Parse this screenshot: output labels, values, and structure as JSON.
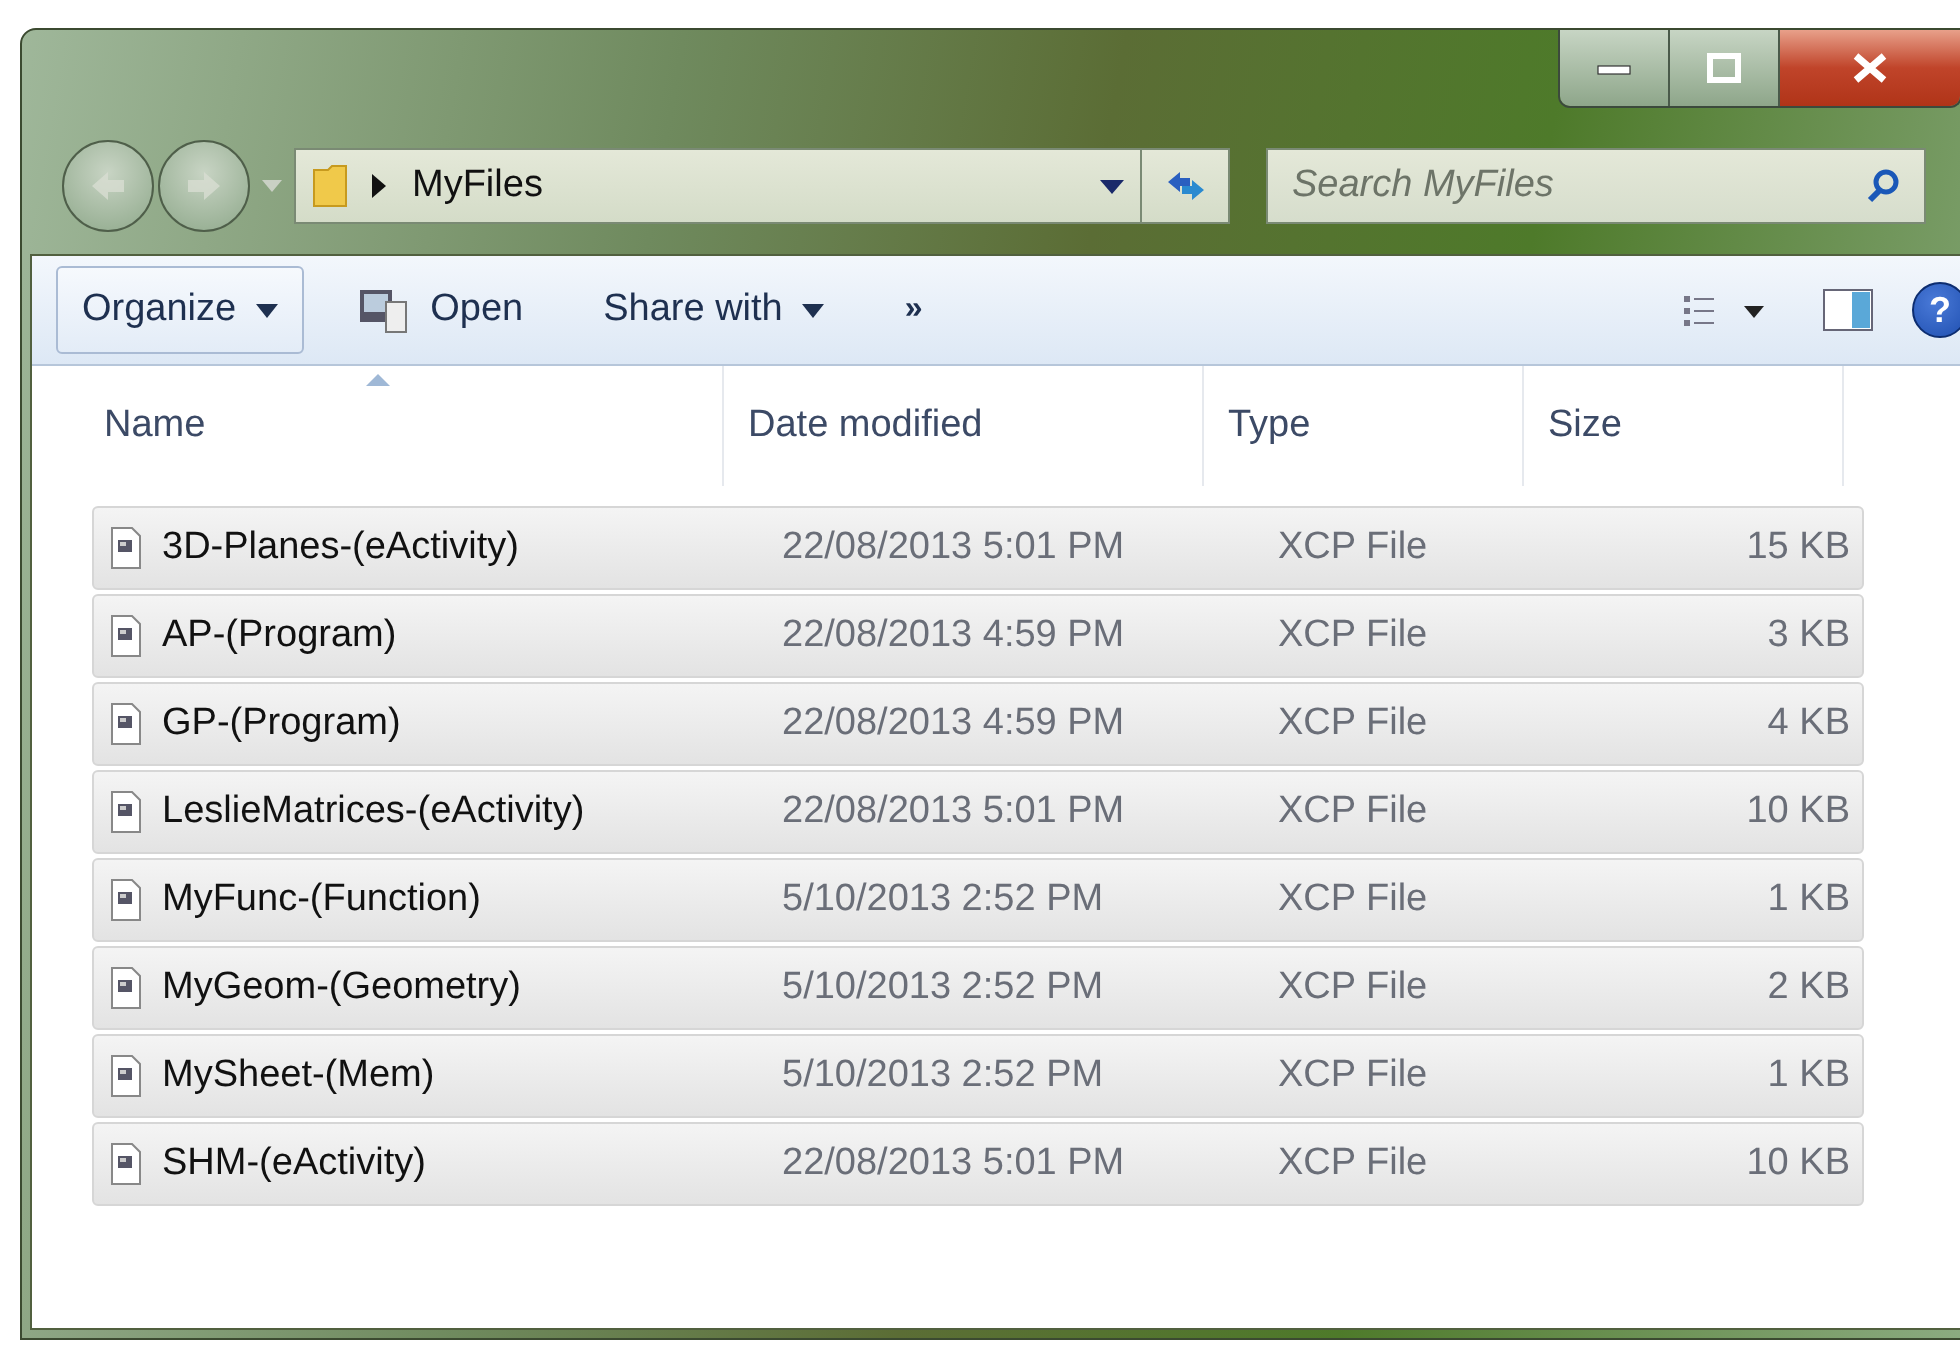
{
  "address_bar": {
    "path": "MyFiles"
  },
  "search": {
    "placeholder": "Search MyFiles"
  },
  "toolbar": [
    {
      "label": "Organize",
      "kind": "menu"
    },
    {
      "label": "Open",
      "kind": "icon"
    },
    {
      "label": "Share with",
      "kind": "menu"
    },
    {
      "label": "»",
      "kind": "more"
    }
  ],
  "help_button": {
    "label": "?"
  },
  "table": {
    "columns": [
      {
        "label": "Name",
        "sorted": true
      },
      {
        "label": "Date modified",
        "sorted": false
      },
      {
        "label": "Type",
        "sorted": false
      },
      {
        "label": "Size",
        "sorted": false
      }
    ],
    "rows": [
      {
        "name": "3D-Planes-(eActivity)",
        "date": "22/08/2013 5:01 PM",
        "type": "XCP File",
        "size": "15 KB",
        "selected": true
      },
      {
        "name": "AP-(Program)",
        "date": "22/08/2013 4:59 PM",
        "type": "XCP File",
        "size": "3 KB",
        "selected": true
      },
      {
        "name": "GP-(Program)",
        "date": "22/08/2013 4:59 PM",
        "type": "XCP File",
        "size": "4 KB",
        "selected": true
      },
      {
        "name": "LeslieMatrices-(eActivity)",
        "date": "22/08/2013 5:01 PM",
        "type": "XCP File",
        "size": "10 KB",
        "selected": true
      },
      {
        "name": "MyFunc-(Function)",
        "date": "5/10/2013 2:52 PM",
        "type": "XCP File",
        "size": "1 KB",
        "selected": true
      },
      {
        "name": "MyGeom-(Geometry)",
        "date": "5/10/2013 2:52 PM",
        "type": "XCP File",
        "size": "2 KB",
        "selected": true
      },
      {
        "name": "MySheet-(Mem)",
        "date": "5/10/2013 2:52 PM",
        "type": "XCP File",
        "size": "1 KB",
        "selected": true
      },
      {
        "name": "SHM-(eActivity)",
        "date": "22/08/2013 5:01 PM",
        "type": "XCP File",
        "size": "10 KB",
        "selected": true
      }
    ]
  }
}
